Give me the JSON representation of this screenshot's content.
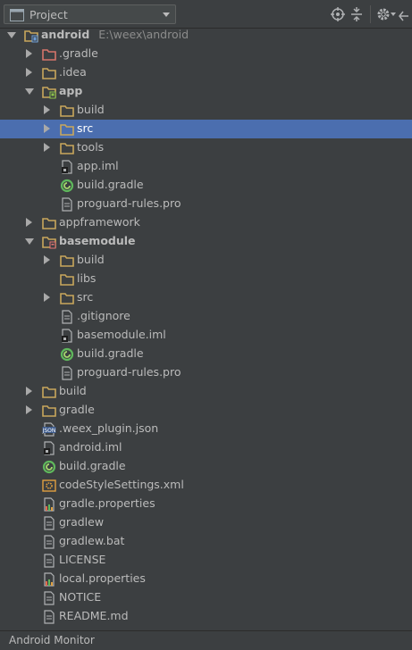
{
  "toolbar": {
    "view_label": "Project",
    "icons": [
      "target-icon",
      "collapse-all-icon",
      "gear-icon",
      "hide-icon"
    ]
  },
  "colors": {
    "background": "#3c3f41",
    "selection": "#4b6eaf",
    "text": "#bbbbbb",
    "folder": "#c9a75c",
    "excluded_folder": "#d6756b"
  },
  "tree": [
    {
      "depth": 0,
      "expanded": true,
      "icon": "module",
      "label": "android",
      "bold": true,
      "sub": "E:\\weex\\android"
    },
    {
      "depth": 1,
      "expanded": false,
      "icon": "folder-red",
      "label": ".gradle"
    },
    {
      "depth": 1,
      "expanded": false,
      "icon": "folder",
      "label": ".idea"
    },
    {
      "depth": 1,
      "expanded": true,
      "icon": "app-module",
      "label": "app",
      "bold": true
    },
    {
      "depth": 2,
      "expanded": false,
      "icon": "folder",
      "label": "build"
    },
    {
      "depth": 2,
      "expanded": false,
      "icon": "folder",
      "label": "src",
      "selected": true
    },
    {
      "depth": 2,
      "expanded": false,
      "icon": "folder",
      "label": "tools"
    },
    {
      "depth": 2,
      "icon": "iml",
      "label": "app.iml"
    },
    {
      "depth": 2,
      "icon": "gradle",
      "label": "build.gradle"
    },
    {
      "depth": 2,
      "icon": "file",
      "label": "proguard-rules.pro"
    },
    {
      "depth": 1,
      "expanded": false,
      "icon": "folder",
      "label": "appframework"
    },
    {
      "depth": 1,
      "expanded": true,
      "icon": "lib-module",
      "label": "basemodule",
      "bold": true
    },
    {
      "depth": 2,
      "expanded": false,
      "icon": "folder",
      "label": "build"
    },
    {
      "depth": 2,
      "icon": "folder",
      "label": "libs"
    },
    {
      "depth": 2,
      "expanded": false,
      "icon": "folder",
      "label": "src"
    },
    {
      "depth": 2,
      "icon": "file",
      "label": ".gitignore"
    },
    {
      "depth": 2,
      "icon": "iml",
      "label": "basemodule.iml"
    },
    {
      "depth": 2,
      "icon": "gradle",
      "label": "build.gradle"
    },
    {
      "depth": 2,
      "icon": "file",
      "label": "proguard-rules.pro"
    },
    {
      "depth": 1,
      "expanded": false,
      "icon": "folder",
      "label": "build"
    },
    {
      "depth": 1,
      "expanded": false,
      "icon": "folder",
      "label": "gradle"
    },
    {
      "depth": 1,
      "icon": "json",
      "label": ".weex_plugin.json"
    },
    {
      "depth": 1,
      "icon": "iml",
      "label": "android.iml"
    },
    {
      "depth": 1,
      "icon": "gradle",
      "label": "build.gradle"
    },
    {
      "depth": 1,
      "icon": "xml",
      "label": "codeStyleSettings.xml"
    },
    {
      "depth": 1,
      "icon": "properties",
      "label": "gradle.properties"
    },
    {
      "depth": 1,
      "icon": "file",
      "label": "gradlew"
    },
    {
      "depth": 1,
      "icon": "file",
      "label": "gradlew.bat"
    },
    {
      "depth": 1,
      "icon": "file",
      "label": "LICENSE"
    },
    {
      "depth": 1,
      "icon": "properties",
      "label": "local.properties"
    },
    {
      "depth": 1,
      "icon": "file",
      "label": "NOTICE"
    },
    {
      "depth": 1,
      "icon": "file",
      "label": "README.md"
    }
  ],
  "bottom_bar": {
    "label": "Android Monitor"
  }
}
